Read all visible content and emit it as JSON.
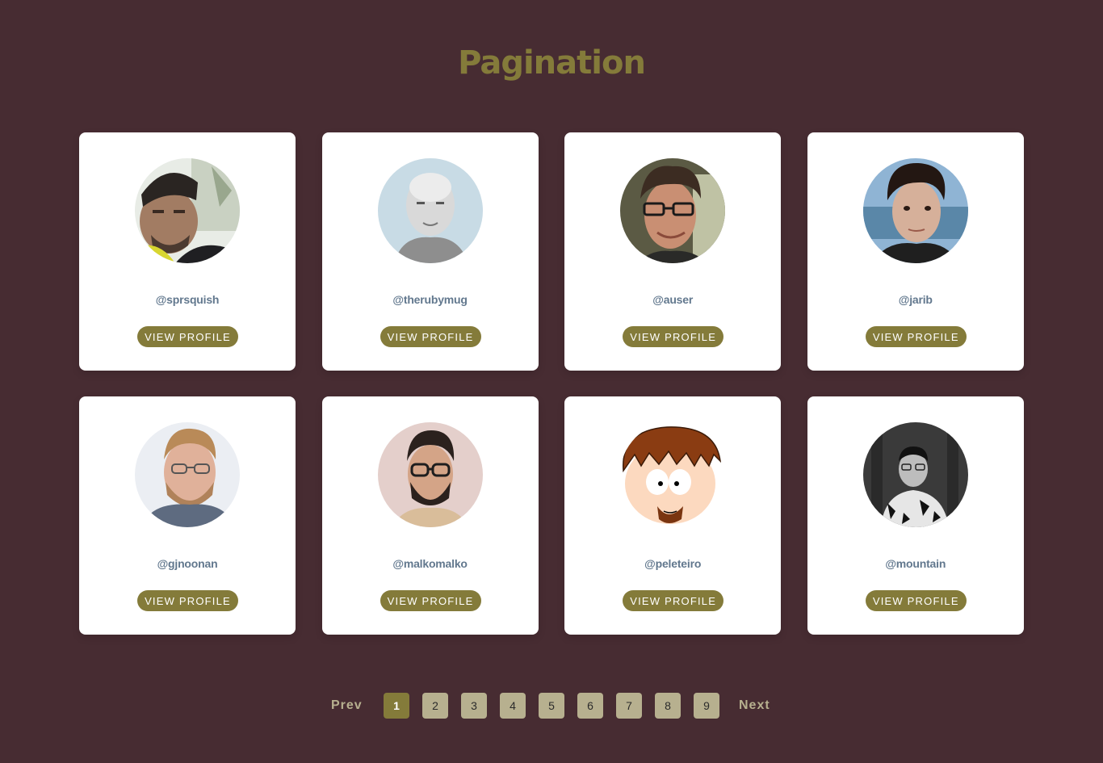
{
  "page": {
    "title": "Pagination"
  },
  "colors": {
    "background": "#472c32",
    "accent": "#847b3a",
    "username": "#62788e",
    "page_button": "#b7b08f"
  },
  "profiles": [
    {
      "username": "@sprsquish",
      "button_label": "VIEW PROFILE",
      "avatar_icon": "bearded-man-photo-icon"
    },
    {
      "username": "@therubymug",
      "button_label": "VIEW PROFILE",
      "avatar_icon": "bald-man-photo-icon"
    },
    {
      "username": "@auser",
      "button_label": "VIEW PROFILE",
      "avatar_icon": "curly-hair-glasses-man-photo-icon"
    },
    {
      "username": "@jarib",
      "button_label": "VIEW PROFILE",
      "avatar_icon": "dark-hair-man-photo-icon"
    },
    {
      "username": "@gjnoonan",
      "button_label": "VIEW PROFILE",
      "avatar_icon": "blond-bearded-man-photo-icon"
    },
    {
      "username": "@malkomalko",
      "button_label": "VIEW PROFILE",
      "avatar_icon": "glasses-bearded-man-photo-icon"
    },
    {
      "username": "@peleteiro",
      "button_label": "VIEW PROFILE",
      "avatar_icon": "cartoon-character-icon"
    },
    {
      "username": "@mountain",
      "button_label": "VIEW PROFILE",
      "avatar_icon": "black-white-man-photo-icon"
    }
  ],
  "pagination": {
    "prev_label": "Prev",
    "next_label": "Next",
    "pages": [
      "1",
      "2",
      "3",
      "4",
      "5",
      "6",
      "7",
      "8",
      "9"
    ],
    "current_page": "1"
  }
}
